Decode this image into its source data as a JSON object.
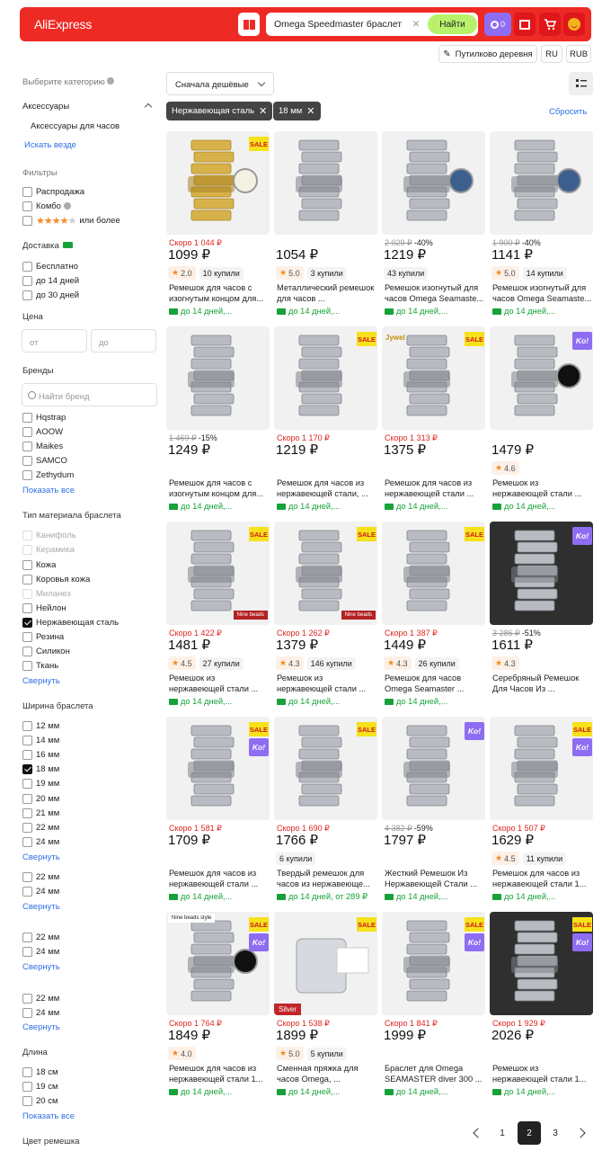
{
  "header": {
    "logo": "AliExpress",
    "search_value": "Omega Speedmaster браслет",
    "search_button": "Найти",
    "coins": "0",
    "colors": {
      "bar": "#ee2a24",
      "accent": "#b7f26a",
      "coins": "#8e6df2"
    }
  },
  "top_pills": {
    "location": "Путилково деревня",
    "lang": "RU",
    "currency": "RUB"
  },
  "sidebar": {
    "category_title": "Выберите категорию",
    "category": "Аксессуары",
    "subcategory": "Аксессуары для часов",
    "search_everywhere": "Искать везде",
    "filters_title": "Фильтры",
    "filters": [
      "Распродажа",
      "Комбо",
      "или более"
    ],
    "delivery_title": "Доставка",
    "delivery": [
      "Бесплатно",
      "до 14 дней",
      "до 30 дней"
    ],
    "price_title": "Цена",
    "price_from": "от",
    "price_to": "до",
    "brands_title": "Бренды",
    "brand_search": "Найти бренд",
    "brands": [
      "Hqstrap",
      "AOOW",
      "Maikes",
      "SAMCO",
      "Zethydum"
    ],
    "show_all": "Показать все",
    "material_title": "Тип материала браслета",
    "materials": [
      "Канифоль",
      "Керамика",
      "Кожа",
      "Коровья кожа",
      "Миланез",
      "Нейлон",
      "Нержавеющая сталь",
      "Резина",
      "Силикон",
      "Ткань"
    ],
    "collapse": "Свернуть",
    "width_title": "Ширина браслета",
    "widths": [
      "12 мм",
      "14 мм",
      "16 мм",
      "18 мм",
      "19 мм",
      "20 мм",
      "21 мм",
      "22 мм",
      "24 мм"
    ],
    "width_group2": [
      "22 мм",
      "24 мм"
    ],
    "width_group3": [
      "22 мм",
      "24 мм"
    ],
    "width_group4": [
      "22 мм",
      "24 мм"
    ],
    "length_title": "Длина",
    "lengths": [
      "18 см",
      "19 см",
      "20 см"
    ],
    "color_title": "Цвет ремешка"
  },
  "toolbar": {
    "sort": "Сначала дешёвые",
    "chips": [
      "Нержавеющая сталь",
      "18 мм"
    ],
    "reset": "Сбросить"
  },
  "products": [
    {
      "old": "Скоро 1 044 ₽",
      "old_red": true,
      "price": "1099 ₽",
      "rating": "2.0",
      "sold": "10 купили",
      "title": "Ремешок для часов с изогнутым концом для...",
      "delivery": "до 14 дней,...",
      "sale": true,
      "ko": false,
      "img": "gold"
    },
    {
      "old": "",
      "price": "1054 ₽",
      "rating": "5.0",
      "sold": "3 купили",
      "title": "Металлический ремешок для часов ...",
      "delivery": "до 14 дней,...",
      "sale": false,
      "ko": false,
      "img": "steel"
    },
    {
      "old": "2 029 ₽",
      "discount": "-40%",
      "price": "1219 ₽",
      "rating": "",
      "sold": "43 купили",
      "title": "Ремешок изогнутый для часов Omega Seamaste...",
      "delivery": "до 14 дней,...",
      "sale": false,
      "ko": false,
      "img": "watch"
    },
    {
      "old": "1 900 ₽",
      "discount": "-40%",
      "price": "1141 ₽",
      "rating": "5.0",
      "sold": "14 купили",
      "title": "Ремешок изогнутый для часов Omega Seamaste...",
      "delivery": "до 14 дней,...",
      "sale": false,
      "ko": false,
      "img": "watch"
    },
    {
      "old": "1 469 ₽",
      "discount": "-15%",
      "price": "1249 ₽",
      "rating": "",
      "sold": "",
      "title": "Ремешок для часов с изогнутым концом для...",
      "delivery": "до 14 дней,...",
      "sale": false,
      "ko": false,
      "img": "steel"
    },
    {
      "old": "Скоро 1 170 ₽",
      "old_red": true,
      "price": "1219 ₽",
      "rating": "",
      "sold": "",
      "title": "Ремешок для часов из нержавеющей стали, ...",
      "delivery": "до 14 дней,...",
      "sale": true,
      "ko": false,
      "img": "steel"
    },
    {
      "old": "Скоро 1 313 ₽",
      "old_red": true,
      "price": "1375 ₽",
      "rating": "",
      "sold": "",
      "title": "Ремешок для часов из нержавеющей стали ...",
      "delivery": "до 14 дней,...",
      "sale": true,
      "ko": false,
      "img": "steel",
      "brand": "Jywel"
    },
    {
      "old": "",
      "price": "1479 ₽",
      "rating": "4.6",
      "sold": "",
      "title": "Ремешок из нержавеющей стали ...",
      "delivery": "до 14 дней,...",
      "sale": false,
      "ko": true,
      "img": "watch2"
    },
    {
      "old": "Скоро 1 422 ₽",
      "old_red": true,
      "price": "1481 ₽",
      "rating": "4.5",
      "sold": "27 купили",
      "title": "Ремешок из нержавеющей стали ...",
      "delivery": "до 14 дней,...",
      "sale": true,
      "ko": false,
      "img": "steel",
      "band": "Nine beads"
    },
    {
      "old": "Скоро 1 262 ₽",
      "old_red": true,
      "price": "1379 ₽",
      "rating": "4.3",
      "sold": "146 купили",
      "title": "Ремешок из нержавеющей стали ...",
      "delivery": "до 14 дней,...",
      "sale": true,
      "ko": false,
      "img": "steel",
      "band": "Nine beads"
    },
    {
      "old": "Скоро 1 387 ₽",
      "old_red": true,
      "price": "1449 ₽",
      "rating": "4.3",
      "sold": "26 купили",
      "title": "Ремешок для часов Omega Seamaster ...",
      "delivery": "до 14 дней,...",
      "sale": true,
      "ko": false,
      "img": "steel"
    },
    {
      "old": "3 286 ₽",
      "discount": "-51%",
      "price": "1611 ₽",
      "rating": "4.3",
      "sold": "",
      "title": "Серебряный Ремешок Для Часов Из ...",
      "delivery": "",
      "sale": false,
      "ko": true,
      "img": "dark"
    },
    {
      "old": "Скоро 1 581 ₽",
      "old_red": true,
      "price": "1709 ₽",
      "rating": "",
      "sold": "",
      "title": "Ремешок для часов из нержавеющей стали ...",
      "delivery": "до 14 дней,...",
      "sale": true,
      "ko": true,
      "img": "steel"
    },
    {
      "old": "Скоро 1 690 ₽",
      "old_red": true,
      "price": "1766 ₽",
      "rating": "",
      "sold": "6 купили",
      "title": "Твердый ремешок для часов из нержавеюще...",
      "delivery": "до 14 дней, от 289 ₽",
      "sale": true,
      "ko": false,
      "img": "steel"
    },
    {
      "old": "4 382 ₽",
      "discount": "-59%",
      "price": "1797 ₽",
      "rating": "",
      "sold": "",
      "title": "Жесткий Ремешок Из Нержавеющей Стали ...",
      "delivery": "до 14 дней,...",
      "sale": false,
      "ko": true,
      "img": "steel"
    },
    {
      "old": "Скоро 1 507 ₽",
      "old_red": true,
      "price": "1629 ₽",
      "rating": "4.5",
      "sold": "11 купили",
      "title": "Ремешок для часов из нержавеющей стали 1...",
      "delivery": "до 14 дней,...",
      "sale": true,
      "ko": true,
      "img": "steel"
    },
    {
      "old": "Скоро 1 764 ₽",
      "old_red": true,
      "price": "1849 ₽",
      "rating": "4.0",
      "sold": "",
      "title": "Ремешок для часов из нержавеющей стали 1...",
      "delivery": "до 14 дней,...",
      "sale": true,
      "ko": true,
      "img": "watch3",
      "band": "Nine beads style"
    },
    {
      "old": "Скоро 1 538 ₽",
      "old_red": true,
      "price": "1899 ₽",
      "rating": "5.0",
      "sold": "5 купили",
      "title": "Сменная пряжка для часов Omega, ...",
      "delivery": "до 14 дней,...",
      "sale": true,
      "ko": false,
      "img": "clasp",
      "tag": "Silver"
    },
    {
      "old": "Скоро 1 841 ₽",
      "old_red": true,
      "price": "1999 ₽",
      "rating": "",
      "sold": "",
      "title": "Браслет для Omega SEAMASTER diver 300 ...",
      "delivery": "до 14 дней,...",
      "sale": true,
      "ko": true,
      "img": "steel"
    },
    {
      "old": "Скоро 1 929 ₽",
      "old_red": true,
      "price": "2026 ₽",
      "rating": "",
      "sold": "",
      "title": "Ремешок из нержавеющей стали 1...",
      "delivery": "до 14 дней,...",
      "sale": true,
      "ko": true,
      "img": "dark"
    }
  ],
  "pagination": {
    "pages": [
      "1",
      "2",
      "3"
    ],
    "current": "2"
  }
}
